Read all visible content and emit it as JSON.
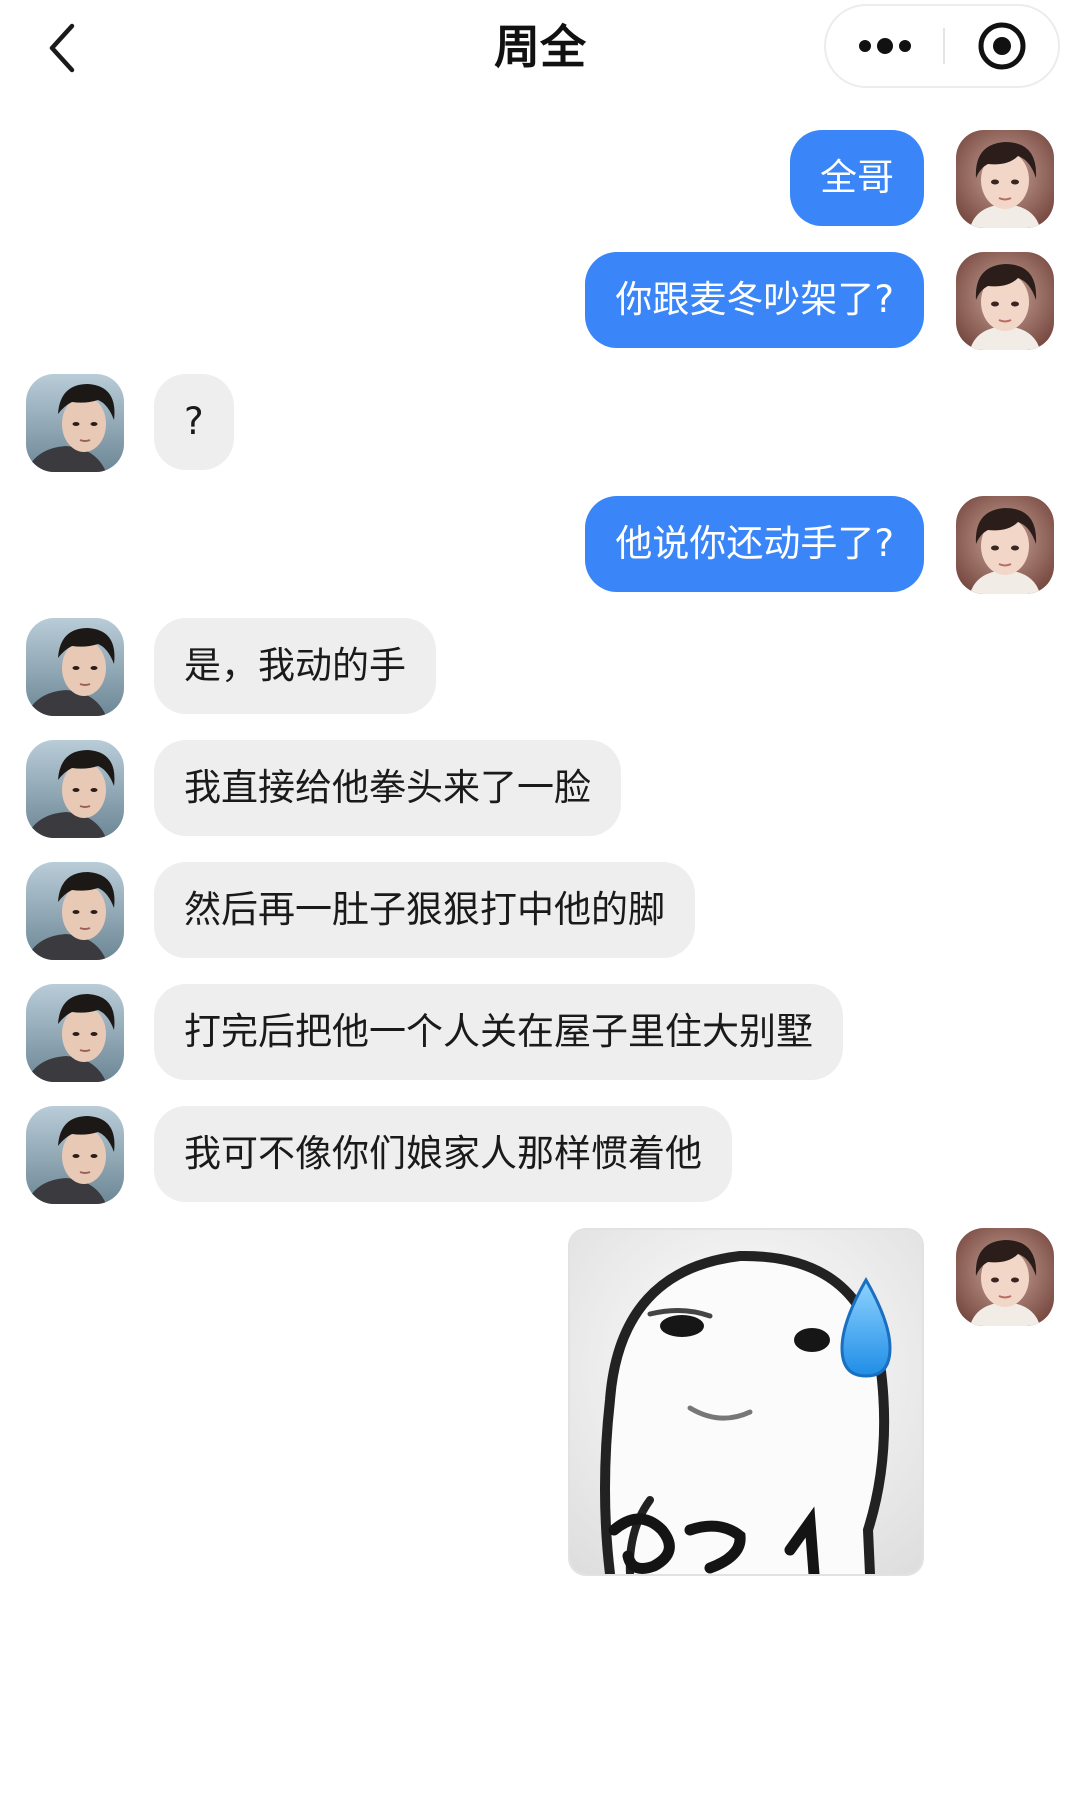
{
  "header": {
    "title": "周全",
    "back_icon": "chevron-left-icon",
    "more_icon": "more-dots-icon",
    "close_icon": "target-close-icon"
  },
  "colors": {
    "my_bubble": "#3a85f7",
    "other_bubble": "#eeeeee",
    "my_text": "#ffffff",
    "other_text": "#1a1a1a"
  },
  "messages": [
    {
      "sender": "me",
      "type": "text",
      "text": "全哥"
    },
    {
      "sender": "me",
      "type": "text",
      "text": "你跟麦冬吵架了?"
    },
    {
      "sender": "other",
      "type": "text",
      "text": "?"
    },
    {
      "sender": "me",
      "type": "text",
      "text": "他说你还动手了?"
    },
    {
      "sender": "other",
      "type": "text",
      "text": "是，我动的手"
    },
    {
      "sender": "other",
      "type": "text",
      "text": "我直接给他拳头来了一脸"
    },
    {
      "sender": "other",
      "type": "text",
      "text": "然后再一肚子狠狠打中他的脚"
    },
    {
      "sender": "other",
      "type": "text",
      "text": "打完后把他一个人关在屋子里住大别墅"
    },
    {
      "sender": "other",
      "type": "text",
      "text": "我可不像你们娘家人那样惯着他"
    },
    {
      "sender": "me",
      "type": "sticker",
      "sticker": "sweat-drop-meme-sticker"
    }
  ]
}
